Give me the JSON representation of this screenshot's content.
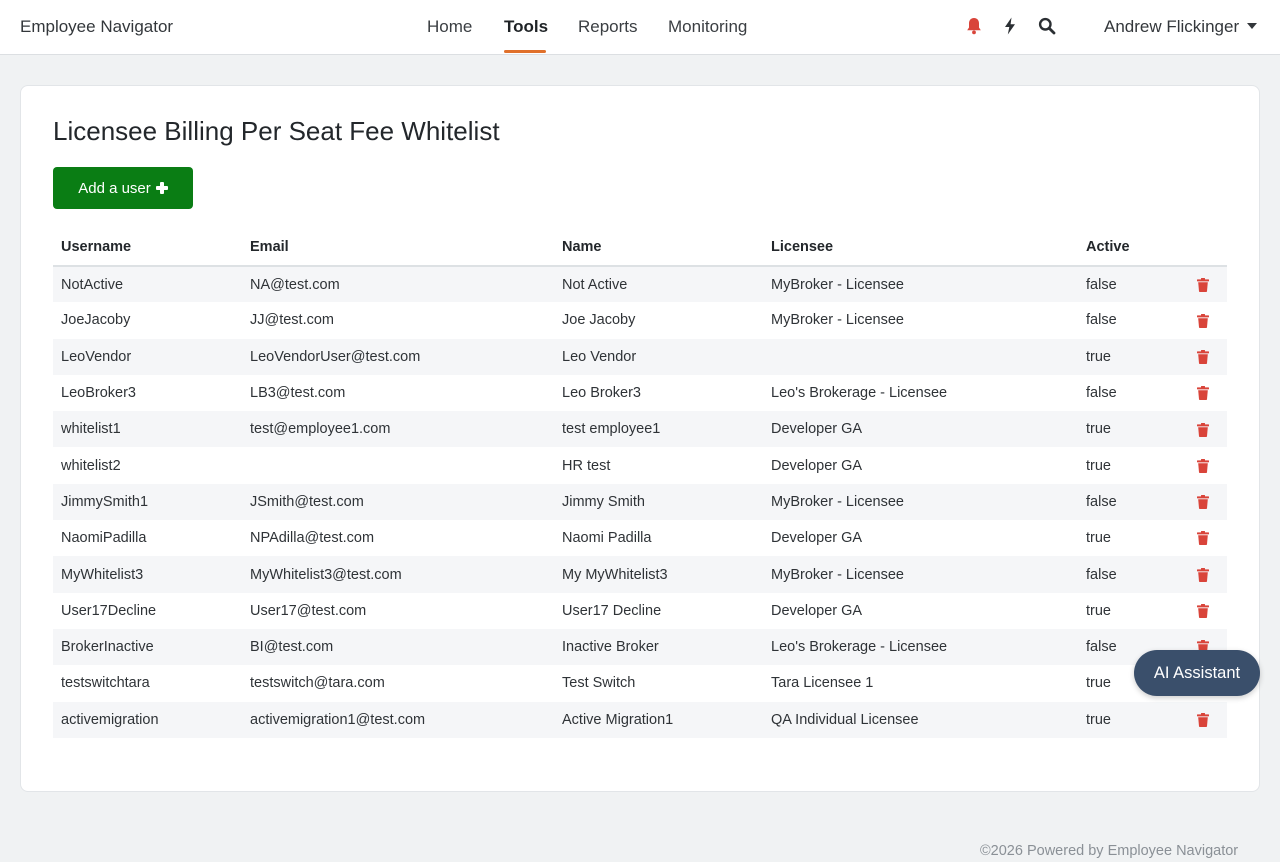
{
  "nav": {
    "brand": "Employee Navigator",
    "tabs": [
      {
        "label": "Home"
      },
      {
        "label": "Tools",
        "active": true
      },
      {
        "label": "Reports"
      },
      {
        "label": "Monitoring"
      }
    ],
    "icons": [
      "bell-icon",
      "bolt-icon",
      "search-icon"
    ],
    "user_name": "Andrew Flickinger",
    "accent_color": "#e0702a",
    "alert_color": "#d9443a"
  },
  "page": {
    "title": "Licensee Billing Per Seat Fee Whitelist",
    "add_button_label": "Add a user",
    "add_button_color": "#0a7d14"
  },
  "table": {
    "headers": [
      "Username",
      "Email",
      "Name",
      "Licensee",
      "Active"
    ],
    "rows": [
      [
        "NotActive",
        "NA@test.com",
        "Not Active",
        "MyBroker - Licensee",
        "false"
      ],
      [
        "JoeJacoby",
        "JJ@test.com",
        "Joe Jacoby",
        "MyBroker - Licensee",
        "false"
      ],
      [
        "LeoVendor",
        "LeoVendorUser@test.com",
        "Leo Vendor",
        "",
        "true"
      ],
      [
        "LeoBroker3",
        "LB3@test.com",
        "Leo Broker3",
        "Leo's Brokerage - Licensee",
        "false"
      ],
      [
        "whitelist1",
        "test@employee1.com",
        "test employee1",
        "Developer GA",
        "true"
      ],
      [
        "whitelist2",
        "",
        "HR test",
        "Developer GA",
        "true"
      ],
      [
        "JimmySmith1",
        "JSmith@test.com",
        "Jimmy Smith",
        "MyBroker - Licensee",
        "false"
      ],
      [
        "NaomiPadilla",
        "NPAdilla@test.com",
        "Naomi Padilla",
        "Developer GA",
        "true"
      ],
      [
        "MyWhitelist3",
        "MyWhitelist3@test.com",
        "My MyWhitelist3",
        "MyBroker - Licensee",
        "false"
      ],
      [
        "User17Decline",
        "User17@test.com",
        "User17 Decline",
        "Developer GA",
        "true"
      ],
      [
        "BrokerInactive",
        "BI@test.com",
        "Inactive Broker",
        "Leo's Brokerage - Licensee",
        "false"
      ],
      [
        "testswitchtara",
        "testswitch@tara.com",
        "Test Switch",
        "Tara Licensee 1",
        "true"
      ],
      [
        "activemigration",
        "activemigration1@test.com",
        "Active Migration1",
        "QA Individual Licensee",
        "true"
      ]
    ],
    "row_action_icon": "trash-icon",
    "row_action_color": "#d9443a"
  },
  "assistant": {
    "label": "AI Assistant",
    "color": "#3a4f6b"
  },
  "footer": {
    "text": "©2026 Powered by Employee Navigator"
  }
}
